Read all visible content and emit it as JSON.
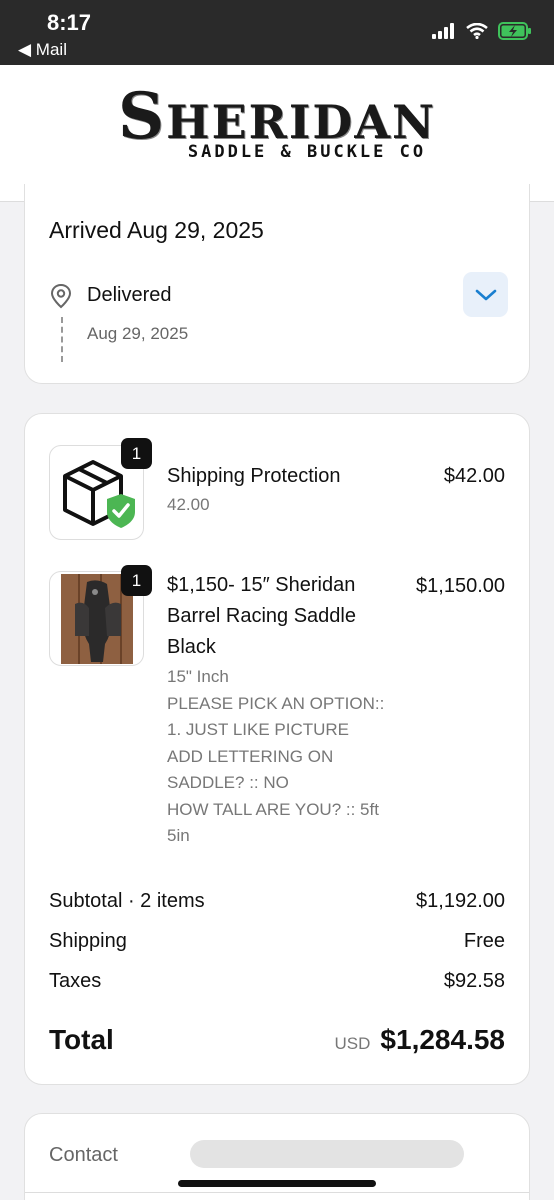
{
  "status": {
    "time": "8:17",
    "back_label": "◀ Mail"
  },
  "brand": {
    "name_initial": "S",
    "name_rest": "HERIDAN",
    "tagline": "SADDLE & BUCKLE CO"
  },
  "delivery": {
    "heading": "Arrived Aug 29, 2025",
    "status_label": "Delivered",
    "status_date": "Aug 29, 2025"
  },
  "items": [
    {
      "quantity": "1",
      "title": "Shipping Protection",
      "price": "$42.00",
      "details": [
        "42.00"
      ]
    },
    {
      "quantity": "1",
      "title": "$1,150- 15″ Sheridan Barrel Racing Saddle Black",
      "price": "$1,150.00",
      "details": [
        "15\" Inch",
        "PLEASE PICK AN OPTION::",
        "1. JUST LIKE PICTURE",
        "ADD LETTERING ON",
        "SADDLE? :: NO",
        "HOW TALL ARE YOU? :: 5ft",
        "5in"
      ]
    }
  ],
  "summary": {
    "subtotal_label": "Subtotal · 2 items",
    "subtotal_value": "$1,192.00",
    "shipping_label": "Shipping",
    "shipping_value": "Free",
    "taxes_label": "Taxes",
    "taxes_value": "$92.58",
    "total_label": "Total",
    "currency": "USD",
    "total_value": "$1,284.58"
  },
  "contact": {
    "label": "Contact"
  },
  "icons": {
    "pin": "location-pin-icon",
    "expand": "chevron-down-icon",
    "signal": "signal-icon",
    "wifi": "wifi-icon",
    "battery": "battery-charging-icon",
    "box": "box-shield-icon"
  },
  "colors": {
    "accent_blue": "#1a7fd0",
    "shield_green": "#4cb653",
    "battery_green": "#3fc25b"
  }
}
